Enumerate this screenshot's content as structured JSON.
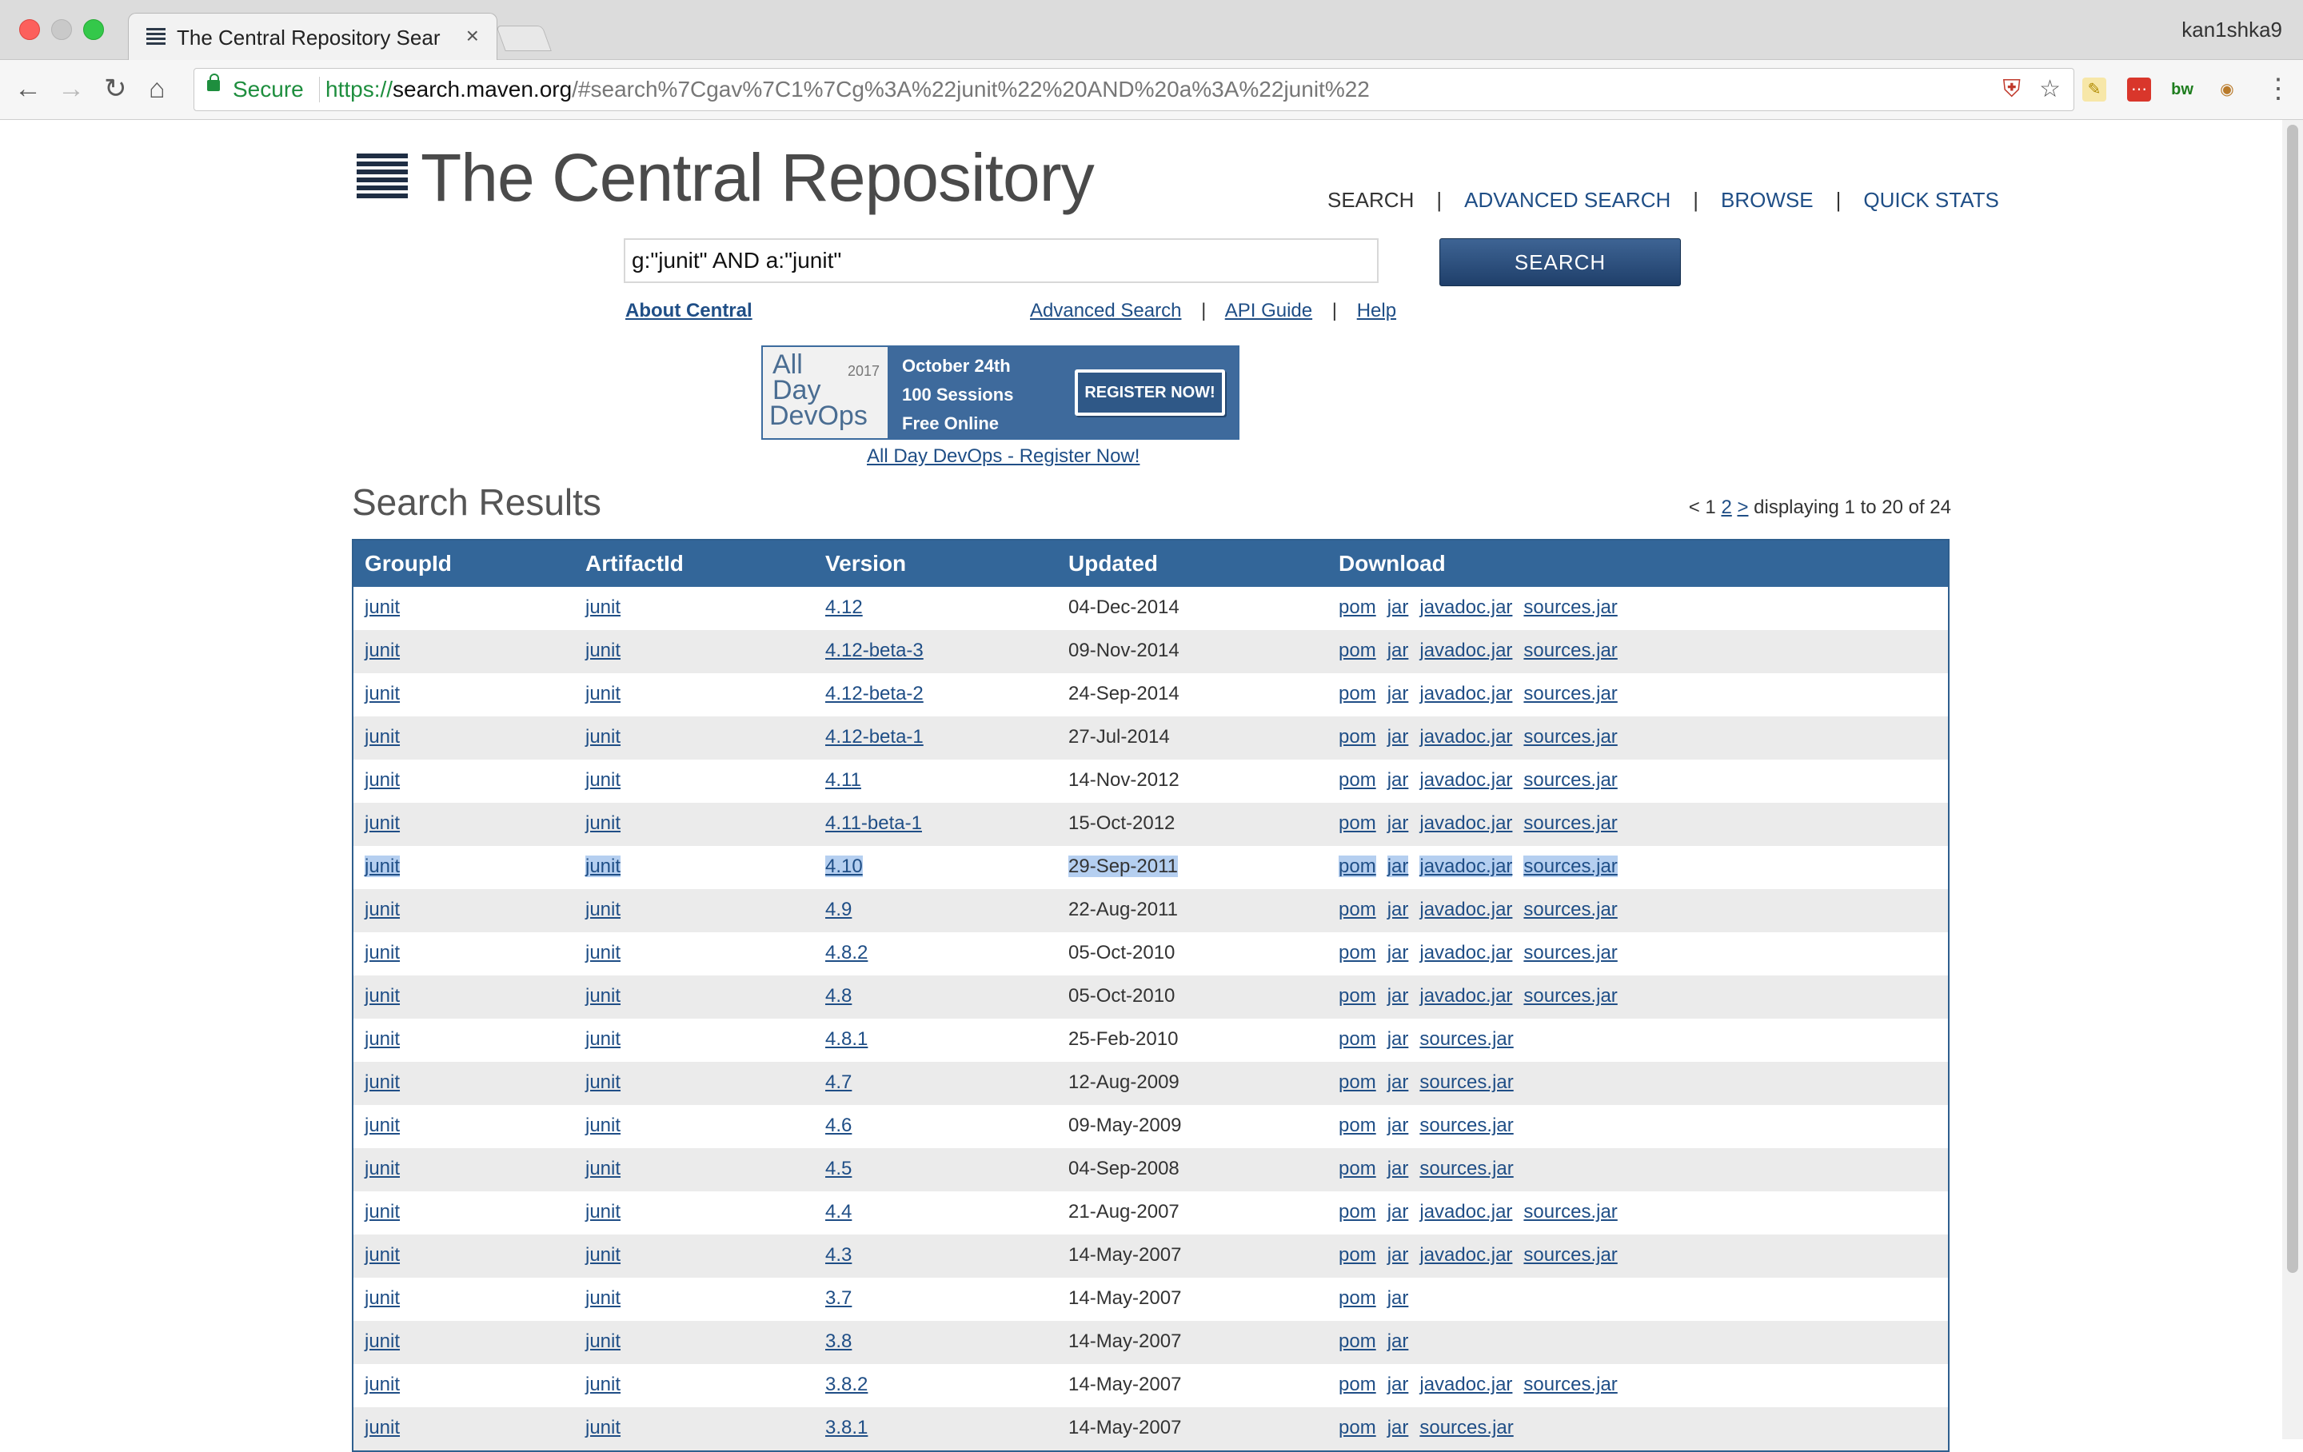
{
  "browser": {
    "tab_title": "The Central Repository Search",
    "tab_close": "×",
    "profile": "kan1shka9",
    "secure_label": "Secure",
    "url_scheme": "https://",
    "url_host": "search.maven.org",
    "url_rest": "/#search%7Cgav%7C1%7Cg%3A%22junit%22%20AND%20a%3A%22junit%22",
    "back_icon": "←",
    "forward_icon": "→",
    "reload_icon": "↻",
    "home_icon": "⌂",
    "star_icon": "☆",
    "menu_icon": "⋮",
    "ext_bw": "bw"
  },
  "site": {
    "logo_text": "The Central Repository",
    "nav": [
      "SEARCH",
      "ADVANCED SEARCH",
      "BROWSE",
      "QUICK STATS"
    ],
    "search_value": "g:\"junit\" AND a:\"junit\"",
    "search_button": "SEARCH",
    "about_link": "About Central",
    "links": [
      "Advanced Search",
      "API Guide",
      "Help"
    ],
    "separator": "|"
  },
  "banner": {
    "left_1": "All",
    "left_2": "Day",
    "left_3": "DevOps",
    "year": "2017",
    "line1": "October 24th",
    "line2": "100 Sessions",
    "line3": "Free Online",
    "register": "REGISTER NOW!",
    "link": "All Day DevOps - Register Now!"
  },
  "results": {
    "title": "Search Results",
    "pager_prev": "< 1",
    "pager_2": "2",
    "pager_next": ">",
    "pager_text": "displaying 1 to 20 of 24",
    "columns": [
      "GroupId",
      "ArtifactId",
      "Version",
      "Updated",
      "Download"
    ],
    "rows": [
      {
        "group": "junit",
        "artifact": "junit",
        "version": "4.12",
        "updated": "04-Dec-2014",
        "downloads": [
          "pom",
          "jar",
          "javadoc.jar",
          "sources.jar"
        ]
      },
      {
        "group": "junit",
        "artifact": "junit",
        "version": "4.12-beta-3",
        "updated": "09-Nov-2014",
        "downloads": [
          "pom",
          "jar",
          "javadoc.jar",
          "sources.jar"
        ]
      },
      {
        "group": "junit",
        "artifact": "junit",
        "version": "4.12-beta-2",
        "updated": "24-Sep-2014",
        "downloads": [
          "pom",
          "jar",
          "javadoc.jar",
          "sources.jar"
        ]
      },
      {
        "group": "junit",
        "artifact": "junit",
        "version": "4.12-beta-1",
        "updated": "27-Jul-2014",
        "downloads": [
          "pom",
          "jar",
          "javadoc.jar",
          "sources.jar"
        ]
      },
      {
        "group": "junit",
        "artifact": "junit",
        "version": "4.11",
        "updated": "14-Nov-2012",
        "downloads": [
          "pom",
          "jar",
          "javadoc.jar",
          "sources.jar"
        ]
      },
      {
        "group": "junit",
        "artifact": "junit",
        "version": "4.11-beta-1",
        "updated": "15-Oct-2012",
        "downloads": [
          "pom",
          "jar",
          "javadoc.jar",
          "sources.jar"
        ]
      },
      {
        "group": "junit",
        "artifact": "junit",
        "version": "4.10",
        "updated": "29-Sep-2011",
        "downloads": [
          "pom",
          "jar",
          "javadoc.jar",
          "sources.jar"
        ],
        "selected": true
      },
      {
        "group": "junit",
        "artifact": "junit",
        "version": "4.9",
        "updated": "22-Aug-2011",
        "downloads": [
          "pom",
          "jar",
          "javadoc.jar",
          "sources.jar"
        ]
      },
      {
        "group": "junit",
        "artifact": "junit",
        "version": "4.8.2",
        "updated": "05-Oct-2010",
        "downloads": [
          "pom",
          "jar",
          "javadoc.jar",
          "sources.jar"
        ]
      },
      {
        "group": "junit",
        "artifact": "junit",
        "version": "4.8",
        "updated": "05-Oct-2010",
        "downloads": [
          "pom",
          "jar",
          "javadoc.jar",
          "sources.jar"
        ]
      },
      {
        "group": "junit",
        "artifact": "junit",
        "version": "4.8.1",
        "updated": "25-Feb-2010",
        "downloads": [
          "pom",
          "jar",
          "sources.jar"
        ]
      },
      {
        "group": "junit",
        "artifact": "junit",
        "version": "4.7",
        "updated": "12-Aug-2009",
        "downloads": [
          "pom",
          "jar",
          "sources.jar"
        ]
      },
      {
        "group": "junit",
        "artifact": "junit",
        "version": "4.6",
        "updated": "09-May-2009",
        "downloads": [
          "pom",
          "jar",
          "sources.jar"
        ]
      },
      {
        "group": "junit",
        "artifact": "junit",
        "version": "4.5",
        "updated": "04-Sep-2008",
        "downloads": [
          "pom",
          "jar",
          "sources.jar"
        ]
      },
      {
        "group": "junit",
        "artifact": "junit",
        "version": "4.4",
        "updated": "21-Aug-2007",
        "downloads": [
          "pom",
          "jar",
          "javadoc.jar",
          "sources.jar"
        ]
      },
      {
        "group": "junit",
        "artifact": "junit",
        "version": "4.3",
        "updated": "14-May-2007",
        "downloads": [
          "pom",
          "jar",
          "javadoc.jar",
          "sources.jar"
        ]
      },
      {
        "group": "junit",
        "artifact": "junit",
        "version": "3.7",
        "updated": "14-May-2007",
        "downloads": [
          "pom",
          "jar"
        ]
      },
      {
        "group": "junit",
        "artifact": "junit",
        "version": "3.8",
        "updated": "14-May-2007",
        "downloads": [
          "pom",
          "jar"
        ]
      },
      {
        "group": "junit",
        "artifact": "junit",
        "version": "3.8.2",
        "updated": "14-May-2007",
        "downloads": [
          "pom",
          "jar",
          "javadoc.jar",
          "sources.jar"
        ]
      },
      {
        "group": "junit",
        "artifact": "junit",
        "version": "3.8.1",
        "updated": "14-May-2007",
        "downloads": [
          "pom",
          "jar",
          "sources.jar"
        ]
      }
    ]
  },
  "colors": {
    "header_blue": "#336699",
    "link_blue": "#1f4e86",
    "row_alt": "#ebebeb",
    "selection": "#b5cff0"
  }
}
